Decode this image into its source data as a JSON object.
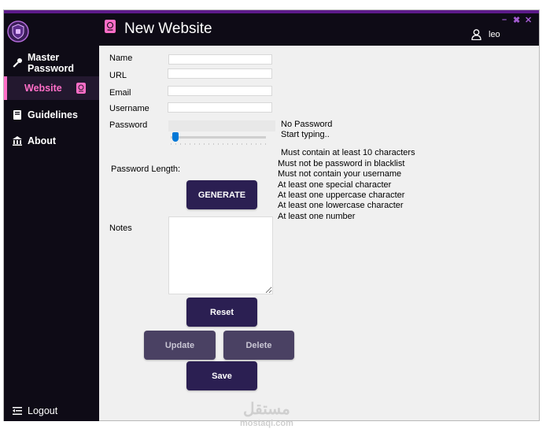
{
  "sidebar": {
    "items": [
      {
        "label_line1": "Master",
        "label_line2": "Password"
      },
      {
        "label": "Website"
      },
      {
        "label": "Guidelines"
      },
      {
        "label": "About"
      }
    ],
    "logout": "Logout"
  },
  "header": {
    "title": "New Website",
    "user": "leo",
    "window_controls": [
      "–",
      "✖",
      "✕"
    ]
  },
  "form": {
    "name_label": "Name",
    "url_label": "URL",
    "email_label": "Email",
    "username_label": "Username",
    "password_label": "Password",
    "password_length_label": "Password Length:",
    "notes_label": "Notes",
    "name_value": "",
    "url_value": "",
    "email_value": "",
    "username_value": "",
    "password_value": "",
    "notes_value": "",
    "password_length_slider": 0
  },
  "status": {
    "strength": "No Password",
    "hint": "Start typing.."
  },
  "requirements": [
    "Must contain at least 10 characters",
    "Must not be password in blacklist",
    "Must not contain your username",
    "At least one special character",
    "At least one uppercase character",
    "At least one lowercase character",
    "At least one number"
  ],
  "buttons": {
    "generate": "GENERATE",
    "reset": "Reset",
    "update": "Update",
    "delete": "Delete",
    "save": "Save"
  },
  "watermark": {
    "arabic": "مستقل",
    "latin": "mostaql.com"
  },
  "colors": {
    "sidebar_bg": "#0e0b16",
    "accent_pink": "#ff6ec7",
    "button_bg": "#2b1f52",
    "top_strip": "#5c1a8a"
  }
}
